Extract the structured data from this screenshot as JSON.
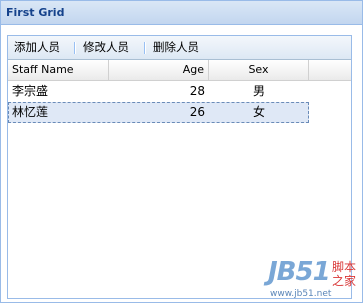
{
  "panel": {
    "title": "First Grid"
  },
  "toolbar": {
    "buttons": [
      "添加人员",
      "修改人员",
      "删除人员"
    ]
  },
  "grid": {
    "columns": [
      "Staff Name",
      "Age",
      "Sex"
    ],
    "rows": [
      {
        "name": "李宗盛",
        "age": "28",
        "sex": "男",
        "selected": false
      },
      {
        "name": "林忆莲",
        "age": "26",
        "sex": "女",
        "selected": true
      }
    ]
  },
  "watermark": {
    "logo": "JB51",
    "cn1": "脚本",
    "cn2": "之家",
    "url": "www.jb51.net"
  },
  "colors": {
    "header_bg": "#c3d6ef",
    "title_text": "#15428b",
    "border": "#99bbe8",
    "selected_row": "#dfe8f6"
  }
}
